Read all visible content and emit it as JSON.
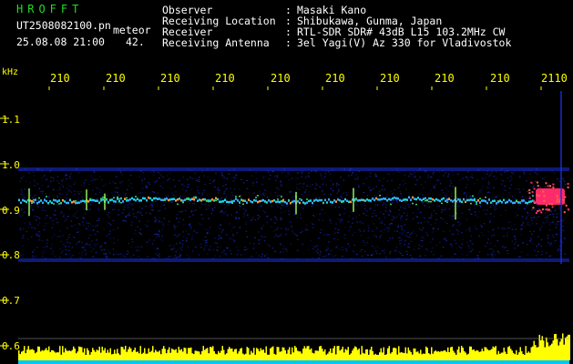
{
  "header": {
    "app_name": "HROFFT",
    "filename": "UT2508082100.pn",
    "type_label": "meteor",
    "datetime": "25.08.08 21:00",
    "count": "42."
  },
  "station_info": [
    {
      "label": "Observer",
      "separator": ":",
      "value": "Masaki Kano"
    },
    {
      "label": "Receiving Location",
      "separator": ":",
      "value": "Shibukawa, Gunma, Japan"
    },
    {
      "label": "Receiver",
      "separator": ":",
      "value": "RTL-SDR SDR# 43dB L15 103.2MHz CW"
    },
    {
      "label": "Receiving Antenna",
      "separator": ":",
      "value": "3el Yagi(V) Az 330 for Vladivostok"
    }
  ],
  "axis": {
    "unit": "kHz",
    "time_ticks": [
      "210",
      "210",
      "210",
      "210",
      "210",
      "210",
      "210",
      "210",
      "210",
      "2110"
    ],
    "freq_ticks": [
      "1.1",
      "1.0",
      "0.9",
      "0.8",
      "0.7",
      "0.6"
    ]
  },
  "colors": {
    "background": "#000000",
    "text": "#ffffff",
    "axis": "#ffff00",
    "app_name": "#22dd22",
    "signal_low": "#1a2fd6",
    "signal_mid": "#19d3e6",
    "signal_high": "#ff2a6a",
    "level_bars": "#ffff00",
    "baseline": "#00c8ff"
  }
}
